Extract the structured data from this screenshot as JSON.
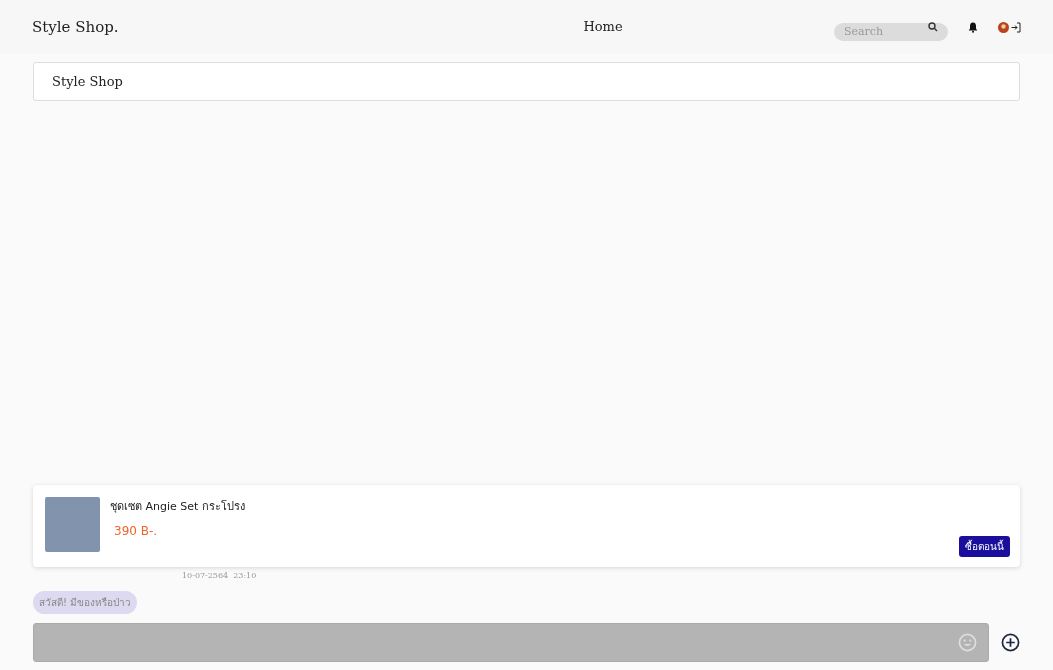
{
  "navbar": {
    "brand": "Style Shop.",
    "link": "Home",
    "search": {
      "placeholder": "Search"
    }
  },
  "chat": {
    "title": "Style Shop",
    "product": {
      "name": "ชุดเซต Angie Set กระโปรง",
      "price": "390 B-.",
      "button": "ซื้อตอนนี้",
      "timestamp": "10-07-2564  23:10"
    },
    "messages": [
      {
        "text": "สวัสดี! มีของหรือป่าว"
      }
    ]
  }
}
